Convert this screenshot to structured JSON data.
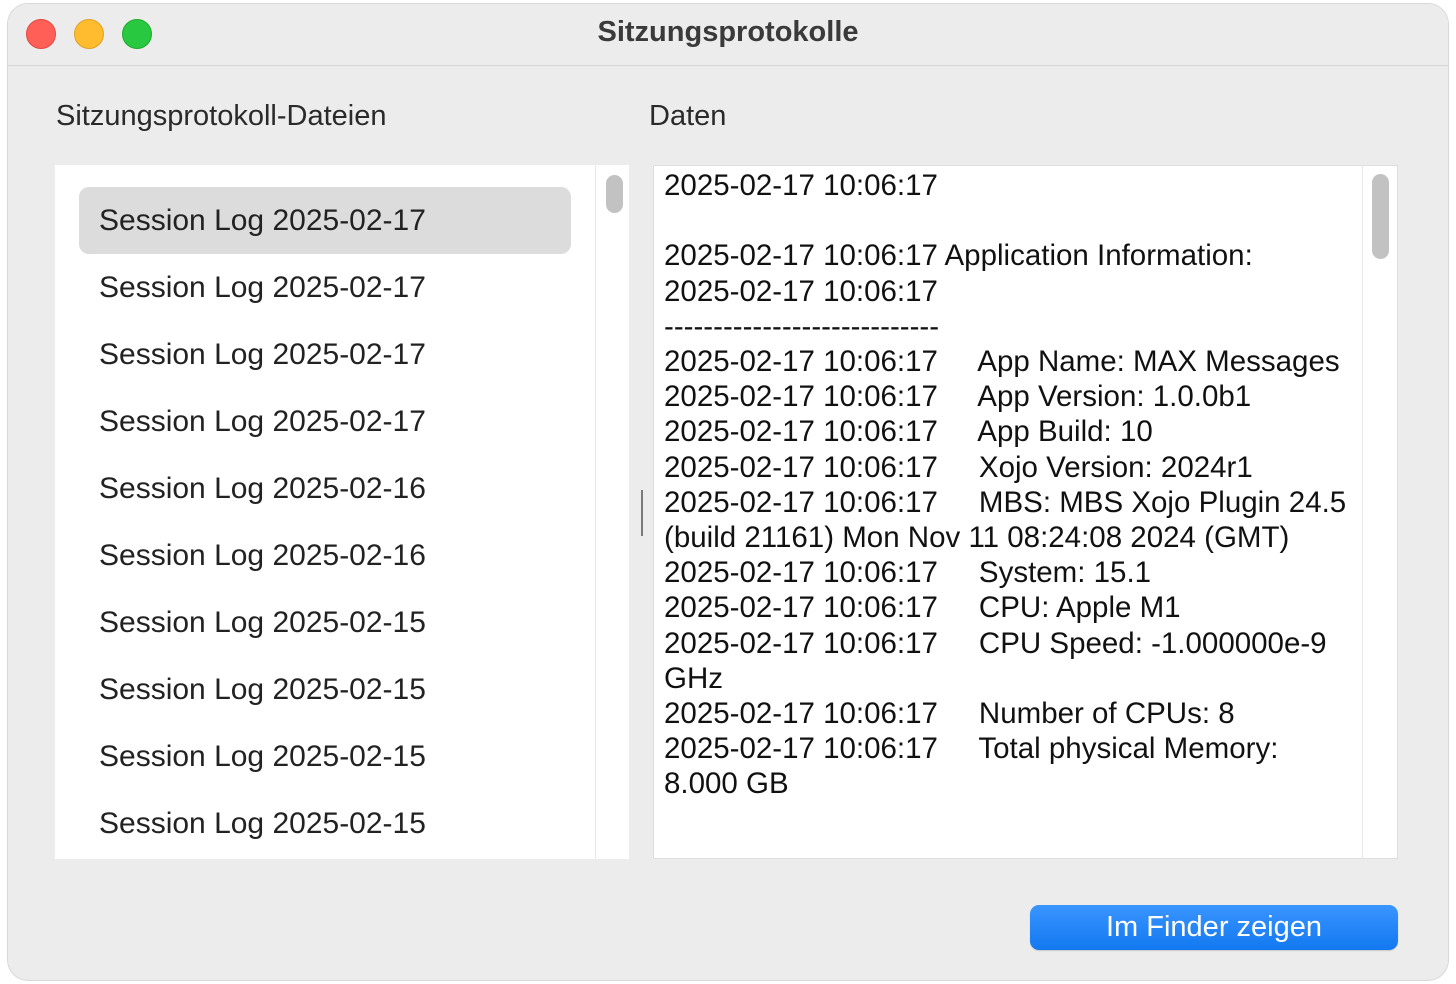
{
  "window": {
    "title": "Sitzungsprotokolle"
  },
  "left_panel": {
    "label": "Sitzungsprotokoll-Dateien",
    "selected_index": 0,
    "files": [
      "Session Log 2025-02-17",
      "Session Log 2025-02-17",
      "Session Log 2025-02-17",
      "Session Log 2025-02-17",
      "Session Log 2025-02-16",
      "Session Log 2025-02-16",
      "Session Log 2025-02-15",
      "Session Log 2025-02-15",
      "Session Log 2025-02-15",
      "Session Log 2025-02-15"
    ]
  },
  "right_panel": {
    "label": "Daten",
    "content": "2025-02-17 10:06:17\n\n2025-02-17 10:06:17 Application Information:\n2025-02-17 10:06:17\n----------------------------\n2025-02-17 10:06:17     App Name: MAX Messages\n2025-02-17 10:06:17     App Version: 1.0.0b1\n2025-02-17 10:06:17     App Build: 10\n2025-02-17 10:06:17     Xojo Version: 2024r1\n2025-02-17 10:06:17     MBS: MBS Xojo Plugin 24.5 (build 21161) Mon Nov 11 08:24:08 2024 (GMT)\n2025-02-17 10:06:17     System: 15.1\n2025-02-17 10:06:17     CPU: Apple M1\n2025-02-17 10:06:17     CPU Speed: -1.000000e-9 GHz\n2025-02-17 10:06:17     Number of CPUs: 8\n2025-02-17 10:06:17     Total physical Memory: 8.000 GB"
  },
  "footer": {
    "finder_button_label": "Im Finder zeigen"
  },
  "colors": {
    "accent": "#1a7ff5",
    "selection": "#dcdcdc",
    "close": "#ff5f57",
    "minimize": "#febc2e",
    "zoom": "#28c840"
  }
}
